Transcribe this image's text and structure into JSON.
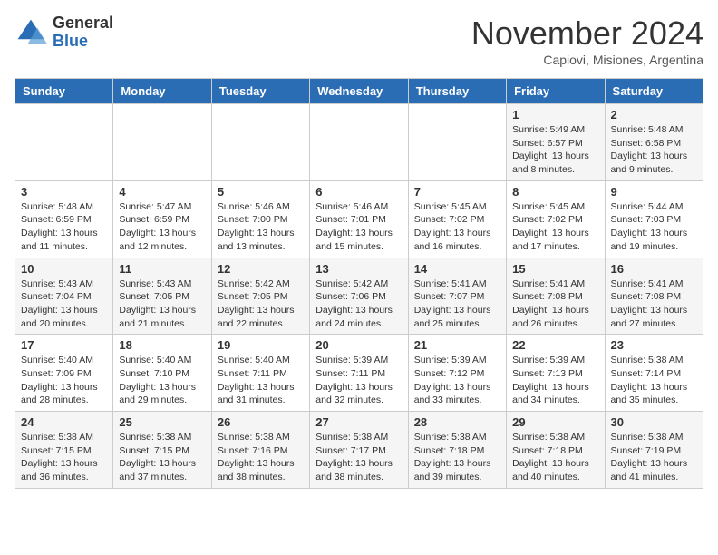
{
  "header": {
    "logo_general": "General",
    "logo_blue": "Blue",
    "month_title": "November 2024",
    "location": "Capiovi, Misiones, Argentina"
  },
  "weekdays": [
    "Sunday",
    "Monday",
    "Tuesday",
    "Wednesday",
    "Thursday",
    "Friday",
    "Saturday"
  ],
  "weeks": [
    [
      {
        "day": "",
        "info": ""
      },
      {
        "day": "",
        "info": ""
      },
      {
        "day": "",
        "info": ""
      },
      {
        "day": "",
        "info": ""
      },
      {
        "day": "",
        "info": ""
      },
      {
        "day": "1",
        "info": "Sunrise: 5:49 AM\nSunset: 6:57 PM\nDaylight: 13 hours\nand 8 minutes."
      },
      {
        "day": "2",
        "info": "Sunrise: 5:48 AM\nSunset: 6:58 PM\nDaylight: 13 hours\nand 9 minutes."
      }
    ],
    [
      {
        "day": "3",
        "info": "Sunrise: 5:48 AM\nSunset: 6:59 PM\nDaylight: 13 hours\nand 11 minutes."
      },
      {
        "day": "4",
        "info": "Sunrise: 5:47 AM\nSunset: 6:59 PM\nDaylight: 13 hours\nand 12 minutes."
      },
      {
        "day": "5",
        "info": "Sunrise: 5:46 AM\nSunset: 7:00 PM\nDaylight: 13 hours\nand 13 minutes."
      },
      {
        "day": "6",
        "info": "Sunrise: 5:46 AM\nSunset: 7:01 PM\nDaylight: 13 hours\nand 15 minutes."
      },
      {
        "day": "7",
        "info": "Sunrise: 5:45 AM\nSunset: 7:02 PM\nDaylight: 13 hours\nand 16 minutes."
      },
      {
        "day": "8",
        "info": "Sunrise: 5:45 AM\nSunset: 7:02 PM\nDaylight: 13 hours\nand 17 minutes."
      },
      {
        "day": "9",
        "info": "Sunrise: 5:44 AM\nSunset: 7:03 PM\nDaylight: 13 hours\nand 19 minutes."
      }
    ],
    [
      {
        "day": "10",
        "info": "Sunrise: 5:43 AM\nSunset: 7:04 PM\nDaylight: 13 hours\nand 20 minutes."
      },
      {
        "day": "11",
        "info": "Sunrise: 5:43 AM\nSunset: 7:05 PM\nDaylight: 13 hours\nand 21 minutes."
      },
      {
        "day": "12",
        "info": "Sunrise: 5:42 AM\nSunset: 7:05 PM\nDaylight: 13 hours\nand 22 minutes."
      },
      {
        "day": "13",
        "info": "Sunrise: 5:42 AM\nSunset: 7:06 PM\nDaylight: 13 hours\nand 24 minutes."
      },
      {
        "day": "14",
        "info": "Sunrise: 5:41 AM\nSunset: 7:07 PM\nDaylight: 13 hours\nand 25 minutes."
      },
      {
        "day": "15",
        "info": "Sunrise: 5:41 AM\nSunset: 7:08 PM\nDaylight: 13 hours\nand 26 minutes."
      },
      {
        "day": "16",
        "info": "Sunrise: 5:41 AM\nSunset: 7:08 PM\nDaylight: 13 hours\nand 27 minutes."
      }
    ],
    [
      {
        "day": "17",
        "info": "Sunrise: 5:40 AM\nSunset: 7:09 PM\nDaylight: 13 hours\nand 28 minutes."
      },
      {
        "day": "18",
        "info": "Sunrise: 5:40 AM\nSunset: 7:10 PM\nDaylight: 13 hours\nand 29 minutes."
      },
      {
        "day": "19",
        "info": "Sunrise: 5:40 AM\nSunset: 7:11 PM\nDaylight: 13 hours\nand 31 minutes."
      },
      {
        "day": "20",
        "info": "Sunrise: 5:39 AM\nSunset: 7:11 PM\nDaylight: 13 hours\nand 32 minutes."
      },
      {
        "day": "21",
        "info": "Sunrise: 5:39 AM\nSunset: 7:12 PM\nDaylight: 13 hours\nand 33 minutes."
      },
      {
        "day": "22",
        "info": "Sunrise: 5:39 AM\nSunset: 7:13 PM\nDaylight: 13 hours\nand 34 minutes."
      },
      {
        "day": "23",
        "info": "Sunrise: 5:38 AM\nSunset: 7:14 PM\nDaylight: 13 hours\nand 35 minutes."
      }
    ],
    [
      {
        "day": "24",
        "info": "Sunrise: 5:38 AM\nSunset: 7:15 PM\nDaylight: 13 hours\nand 36 minutes."
      },
      {
        "day": "25",
        "info": "Sunrise: 5:38 AM\nSunset: 7:15 PM\nDaylight: 13 hours\nand 37 minutes."
      },
      {
        "day": "26",
        "info": "Sunrise: 5:38 AM\nSunset: 7:16 PM\nDaylight: 13 hours\nand 38 minutes."
      },
      {
        "day": "27",
        "info": "Sunrise: 5:38 AM\nSunset: 7:17 PM\nDaylight: 13 hours\nand 38 minutes."
      },
      {
        "day": "28",
        "info": "Sunrise: 5:38 AM\nSunset: 7:18 PM\nDaylight: 13 hours\nand 39 minutes."
      },
      {
        "day": "29",
        "info": "Sunrise: 5:38 AM\nSunset: 7:18 PM\nDaylight: 13 hours\nand 40 minutes."
      },
      {
        "day": "30",
        "info": "Sunrise: 5:38 AM\nSunset: 7:19 PM\nDaylight: 13 hours\nand 41 minutes."
      }
    ]
  ]
}
